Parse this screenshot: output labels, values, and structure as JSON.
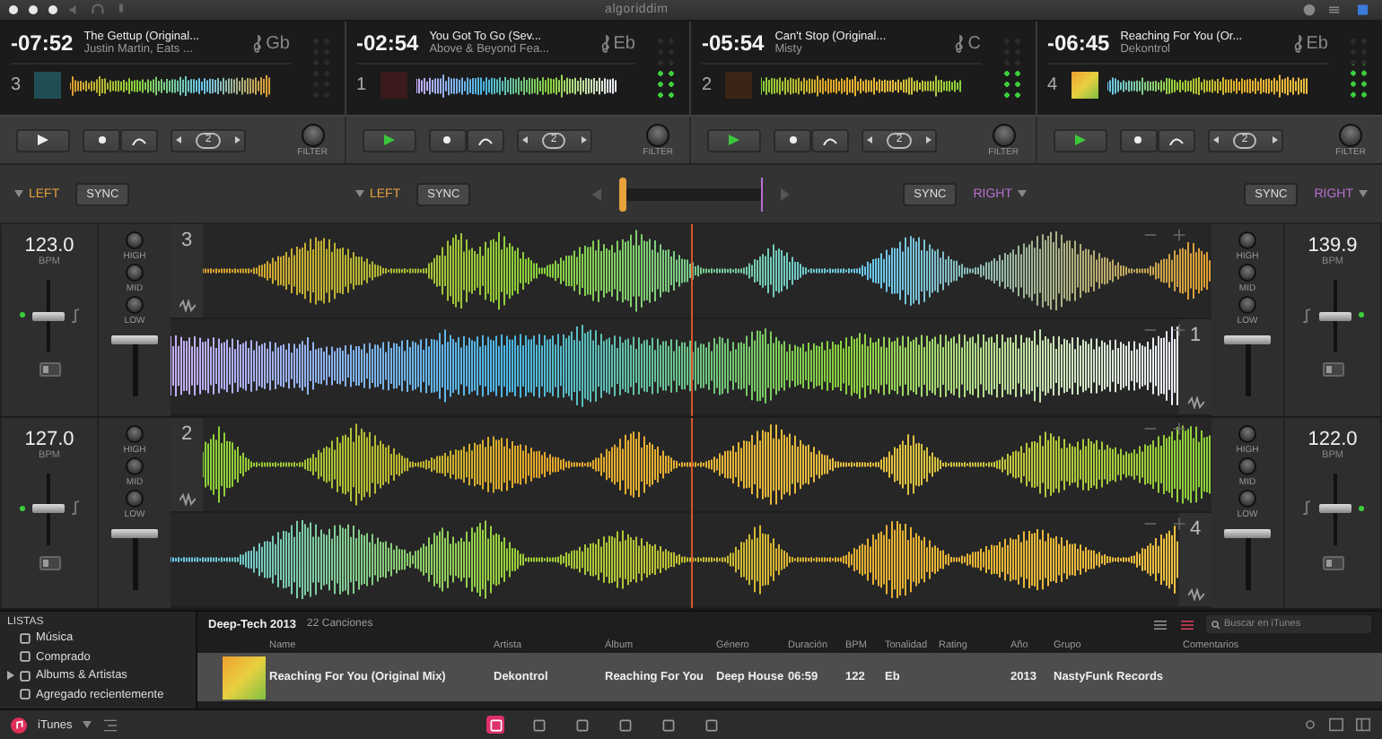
{
  "app": {
    "logo": "algoriddim"
  },
  "decks": [
    {
      "time": "-07:52",
      "title": "The Gettup (Original...",
      "artist": "Justin Martin, Eats ...",
      "key": "Gb",
      "number": "3",
      "playing": false,
      "meter": {
        "level": 0
      },
      "filter": "FILTER",
      "loop": "2"
    },
    {
      "time": "-02:54",
      "title": "You Got To Go (Sev...",
      "artist": "Above & Beyond Fea...",
      "key": "Eb",
      "number": "1",
      "playing": true,
      "meter": {
        "level": 0.5
      },
      "filter": "FILTER",
      "loop": "2"
    },
    {
      "time": "-05:54",
      "title": "Can't Stop (Original...",
      "artist": "Misty",
      "key": "C",
      "number": "2",
      "playing": true,
      "meter": {
        "level": 0.5
      },
      "filter": "FILTER",
      "loop": "2"
    },
    {
      "time": "-06:45",
      "title": "Reaching For You (Or...",
      "artist": "Dekontrol",
      "key": "Eb",
      "number": "4",
      "playing": true,
      "meter": {
        "level": 0.55
      },
      "filter": "FILTER",
      "loop": "2"
    }
  ],
  "assignments": [
    {
      "side": "LEFT",
      "sync": "SYNC",
      "kind": "left",
      "color": "#e8a23a"
    },
    {
      "side": "LEFT",
      "sync": "SYNC",
      "kind": "left",
      "color": "#e8a23a"
    },
    {
      "side": "RIGHT",
      "sync": "SYNC",
      "kind": "right",
      "color": "#b870d0"
    },
    {
      "side": "RIGHT",
      "sync": "SYNC",
      "kind": "right",
      "color": "#b870d0"
    }
  ],
  "crossfader": {
    "level": 0
  },
  "mixer": [
    {
      "left": {
        "bpm": "123.0",
        "unit": "BPM",
        "eq": [
          "HIGH",
          "MID",
          "LOW"
        ],
        "pitch": {
          "level": 0.5
        },
        "volume": {
          "level": 1
        }
      },
      "lanes": [
        {
          "number": "3"
        },
        {
          "number": "1"
        }
      ],
      "right": {
        "bpm": "139.9",
        "unit": "BPM",
        "eq": [
          "HIGH",
          "MID",
          "LOW"
        ],
        "pitch": {
          "level": 0.5
        },
        "volume": {
          "level": 1
        }
      }
    },
    {
      "left": {
        "bpm": "127.0",
        "unit": "BPM",
        "eq": [
          "HIGH",
          "MID",
          "LOW"
        ],
        "pitch": {
          "level": 0.5
        },
        "volume": {
          "level": 1
        }
      },
      "lanes": [
        {
          "number": "2"
        },
        {
          "number": "4"
        }
      ],
      "right": {
        "bpm": "122.0",
        "unit": "BPM",
        "eq": [
          "HIGH",
          "MID",
          "LOW"
        ],
        "pitch": {
          "level": 0.5
        },
        "volume": {
          "level": 1
        }
      }
    }
  ],
  "library": {
    "sidebar": {
      "title": "LISTAS",
      "items": [
        {
          "label": "Música",
          "expandable": false
        },
        {
          "label": "Comprado",
          "expandable": false
        },
        {
          "label": "Albums & Artistas",
          "expandable": true
        },
        {
          "label": "Agregado recientemente",
          "expandable": false
        }
      ]
    },
    "playlist": {
      "title": "Deep-Tech 2013",
      "count": "22 Canciones"
    },
    "search": {
      "placeholder": "Buscar en iTunes"
    },
    "columns": [
      "Name",
      "Artista",
      "Álbum",
      "Género",
      "Duración",
      "BPM",
      "Tonalidad",
      "Rating",
      "Año",
      "Grupo",
      "Comentarios"
    ],
    "rows": [
      {
        "cells": [
          "Reaching For You (Original Mix)",
          "Dekontrol",
          "Reaching For You",
          "Deep House",
          "06:59",
          "122",
          "Eb",
          "",
          "2013",
          "NastyFunk Records",
          ""
        ],
        "selected": true
      }
    ]
  },
  "bottom_bar": {
    "source": "iTunes",
    "views": [
      {
        "selected": true
      },
      {
        "selected": false
      },
      {
        "selected": false
      },
      {
        "selected": false
      },
      {
        "selected": false
      },
      {
        "selected": false
      }
    ]
  }
}
